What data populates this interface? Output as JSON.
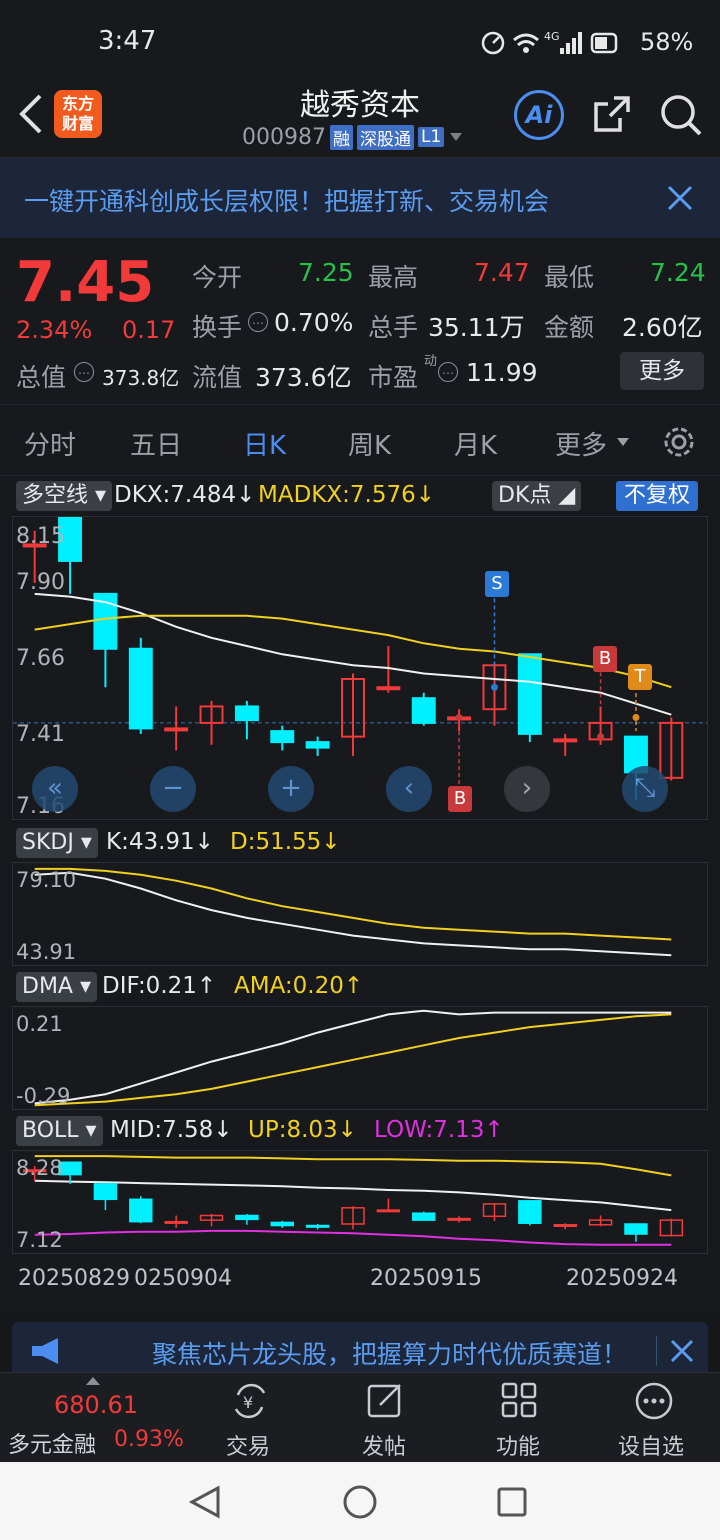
{
  "status": {
    "time": "3:47",
    "network": "4G",
    "battery": "58%"
  },
  "nav": {
    "logo_line1": "东方",
    "logo_line2": "财富",
    "title": "越秀资本",
    "code": "000987",
    "tags": [
      "融",
      "深股通",
      "L1"
    ],
    "ai": "Ai"
  },
  "banner": {
    "text": "一键开通科创成长层权限！把握打新、交易机会"
  },
  "quote": {
    "price": "7.45",
    "change_pct": "2.34%",
    "change": "0.17",
    "open_label": "今开",
    "open": "7.25",
    "high_label": "最高",
    "high": "7.47",
    "low_label": "最低",
    "low": "7.24",
    "turnover_label": "换手",
    "turnover": "0.70%",
    "volume_label": "总手",
    "volume": "35.11万",
    "amount_label": "金额",
    "amount": "2.60亿",
    "mcap_label": "总值",
    "mcap": "373.8亿",
    "float_label": "流值",
    "float": "373.6亿",
    "pe_label": "市盈",
    "pe_sup": "动",
    "pe": "11.99",
    "more": "更多"
  },
  "tabs": [
    "分时",
    "五日",
    "日K",
    "周K",
    "月K",
    "更多"
  ],
  "main": {
    "indicator": "多空线",
    "dkx": "DKX:7.484↓",
    "madkx": "MADKX:7.576↓",
    "dk_point": "DK点",
    "fq": "不复权",
    "yticks": [
      "8.15",
      "7.90",
      "7.66",
      "7.41",
      "7.16"
    ],
    "signal_s": "S",
    "signal_b": "B",
    "signal_t": "T"
  },
  "skdj": {
    "name": "SKDJ",
    "k": "K:43.91↓",
    "d": "D:51.55↓",
    "ytop": "79.10",
    "ybot": "43.91"
  },
  "dma": {
    "name": "DMA",
    "dif": "DIF:0.21↑",
    "ama": "AMA:0.20↑",
    "ytop": "0.21",
    "ybot": "-0.29"
  },
  "boll": {
    "name": "BOLL",
    "mid": "MID:7.58↓",
    "up": "UP:8.03↓",
    "low": "LOW:7.13↑",
    "ytop": "8.28",
    "ybot": "7.12"
  },
  "xaxis": [
    "20250829",
    "0250904",
    "20250915",
    "20250924"
  ],
  "ad2": {
    "text": "聚焦芯片龙头股，把握算力时代优质赛道！"
  },
  "bottom": {
    "index_value": "680.61",
    "index_name": "多元金融",
    "index_pct": "0.93%",
    "items": [
      "交易",
      "发帖",
      "功能",
      "设自选"
    ]
  },
  "colors": {
    "up": "#f23a3a",
    "down": "#27c04a",
    "accent": "#4b8df0",
    "cyan": "#00f0ff",
    "yellow": "#f0d020",
    "magenta": "#e030e0"
  },
  "chart_data": {
    "type": "candlestick",
    "dates": [
      "20250829",
      "",
      "",
      "",
      "0250904",
      "",
      "",
      "",
      "",
      "",
      "",
      "",
      "20250915",
      "",
      "",
      "",
      "",
      "",
      "",
      "20250924"
    ],
    "candles": [
      {
        "o": 8.1,
        "c": 8.1,
        "h": 8.15,
        "l": 7.96
      },
      {
        "o": 8.2,
        "c": 8.04,
        "h": 8.2,
        "l": 7.92
      },
      {
        "o": 7.92,
        "c": 7.72,
        "h": 7.92,
        "l": 7.58
      },
      {
        "o": 7.72,
        "c": 7.43,
        "h": 7.76,
        "l": 7.41
      },
      {
        "o": 7.43,
        "c": 7.43,
        "h": 7.51,
        "l": 7.35
      },
      {
        "o": 7.45,
        "c": 7.51,
        "h": 7.53,
        "l": 7.37
      },
      {
        "o": 7.51,
        "c": 7.46,
        "h": 7.53,
        "l": 7.39
      },
      {
        "o": 7.42,
        "c": 7.38,
        "h": 7.44,
        "l": 7.35
      },
      {
        "o": 7.38,
        "c": 7.36,
        "h": 7.4,
        "l": 7.33
      },
      {
        "o": 7.4,
        "c": 7.61,
        "h": 7.63,
        "l": 7.33
      },
      {
        "o": 7.58,
        "c": 7.58,
        "h": 7.73,
        "l": 7.56
      },
      {
        "o": 7.54,
        "c": 7.45,
        "h": 7.56,
        "l": 7.44
      },
      {
        "o": 7.47,
        "c": 7.47,
        "h": 7.5,
        "l": 7.42
      },
      {
        "o": 7.5,
        "c": 7.66,
        "h": 7.67,
        "l": 7.44
      },
      {
        "o": 7.7,
        "c": 7.41,
        "h": 7.7,
        "l": 7.38
      },
      {
        "o": 7.39,
        "c": 7.39,
        "h": 7.41,
        "l": 7.33
      },
      {
        "o": 7.39,
        "c": 7.45,
        "h": 7.51,
        "l": 7.37
      },
      {
        "o": 7.4,
        "c": 7.27,
        "h": 7.4,
        "l": 7.17
      },
      {
        "o": 7.25,
        "c": 7.45,
        "h": 7.47,
        "l": 7.24
      }
    ],
    "dkx": [
      7.92,
      7.91,
      7.89,
      7.85,
      7.8,
      7.76,
      7.73,
      7.7,
      7.68,
      7.66,
      7.65,
      7.63,
      7.62,
      7.61,
      7.6,
      7.58,
      7.56,
      7.52,
      7.48
    ],
    "madkx": [
      7.79,
      7.81,
      7.83,
      7.84,
      7.84,
      7.84,
      7.84,
      7.83,
      7.81,
      7.79,
      7.77,
      7.74,
      7.72,
      7.71,
      7.69,
      7.67,
      7.65,
      7.62,
      7.58
    ],
    "y_range": [
      7.1,
      8.2
    ],
    "skdj_k": [
      85,
      86,
      83,
      78,
      72,
      67,
      63,
      60,
      57,
      54,
      52,
      50,
      49,
      48,
      47,
      47,
      46,
      45,
      44
    ],
    "skdj_d": [
      88,
      88,
      87,
      85,
      82,
      78,
      73,
      69,
      66,
      63,
      60,
      58,
      57,
      56,
      55,
      55,
      54,
      53,
      52
    ],
    "skdj_range": [
      40,
      90
    ],
    "dma_dif": [
      -0.29,
      -0.27,
      -0.24,
      -0.18,
      -0.12,
      -0.06,
      -0.01,
      0.04,
      0.1,
      0.15,
      0.2,
      0.22,
      0.2,
      0.21,
      0.21,
      0.21,
      0.21,
      0.21,
      0.21
    ],
    "dma_ama": [
      -0.3,
      -0.29,
      -0.28,
      -0.26,
      -0.24,
      -0.21,
      -0.17,
      -0.13,
      -0.09,
      -0.05,
      -0.01,
      0.03,
      0.07,
      0.1,
      0.13,
      0.15,
      0.17,
      0.19,
      0.2
    ],
    "dma_range": [
      -0.31,
      0.23
    ],
    "boll_up": [
      8.28,
      8.28,
      8.28,
      8.27,
      8.26,
      8.26,
      8.26,
      8.25,
      8.24,
      8.24,
      8.24,
      8.23,
      8.22,
      8.22,
      8.21,
      8.2,
      8.18,
      8.11,
      8.03
    ],
    "boll_mid": [
      7.96,
      7.95,
      7.94,
      7.93,
      7.92,
      7.91,
      7.9,
      7.89,
      7.87,
      7.86,
      7.84,
      7.83,
      7.81,
      7.78,
      7.74,
      7.71,
      7.68,
      7.63,
      7.58
    ],
    "boll_low": [
      7.26,
      7.27,
      7.29,
      7.3,
      7.3,
      7.31,
      7.31,
      7.3,
      7.29,
      7.28,
      7.26,
      7.24,
      7.21,
      7.19,
      7.16,
      7.14,
      7.13,
      7.13,
      7.13
    ],
    "boll_range": [
      7.05,
      8.32
    ]
  }
}
